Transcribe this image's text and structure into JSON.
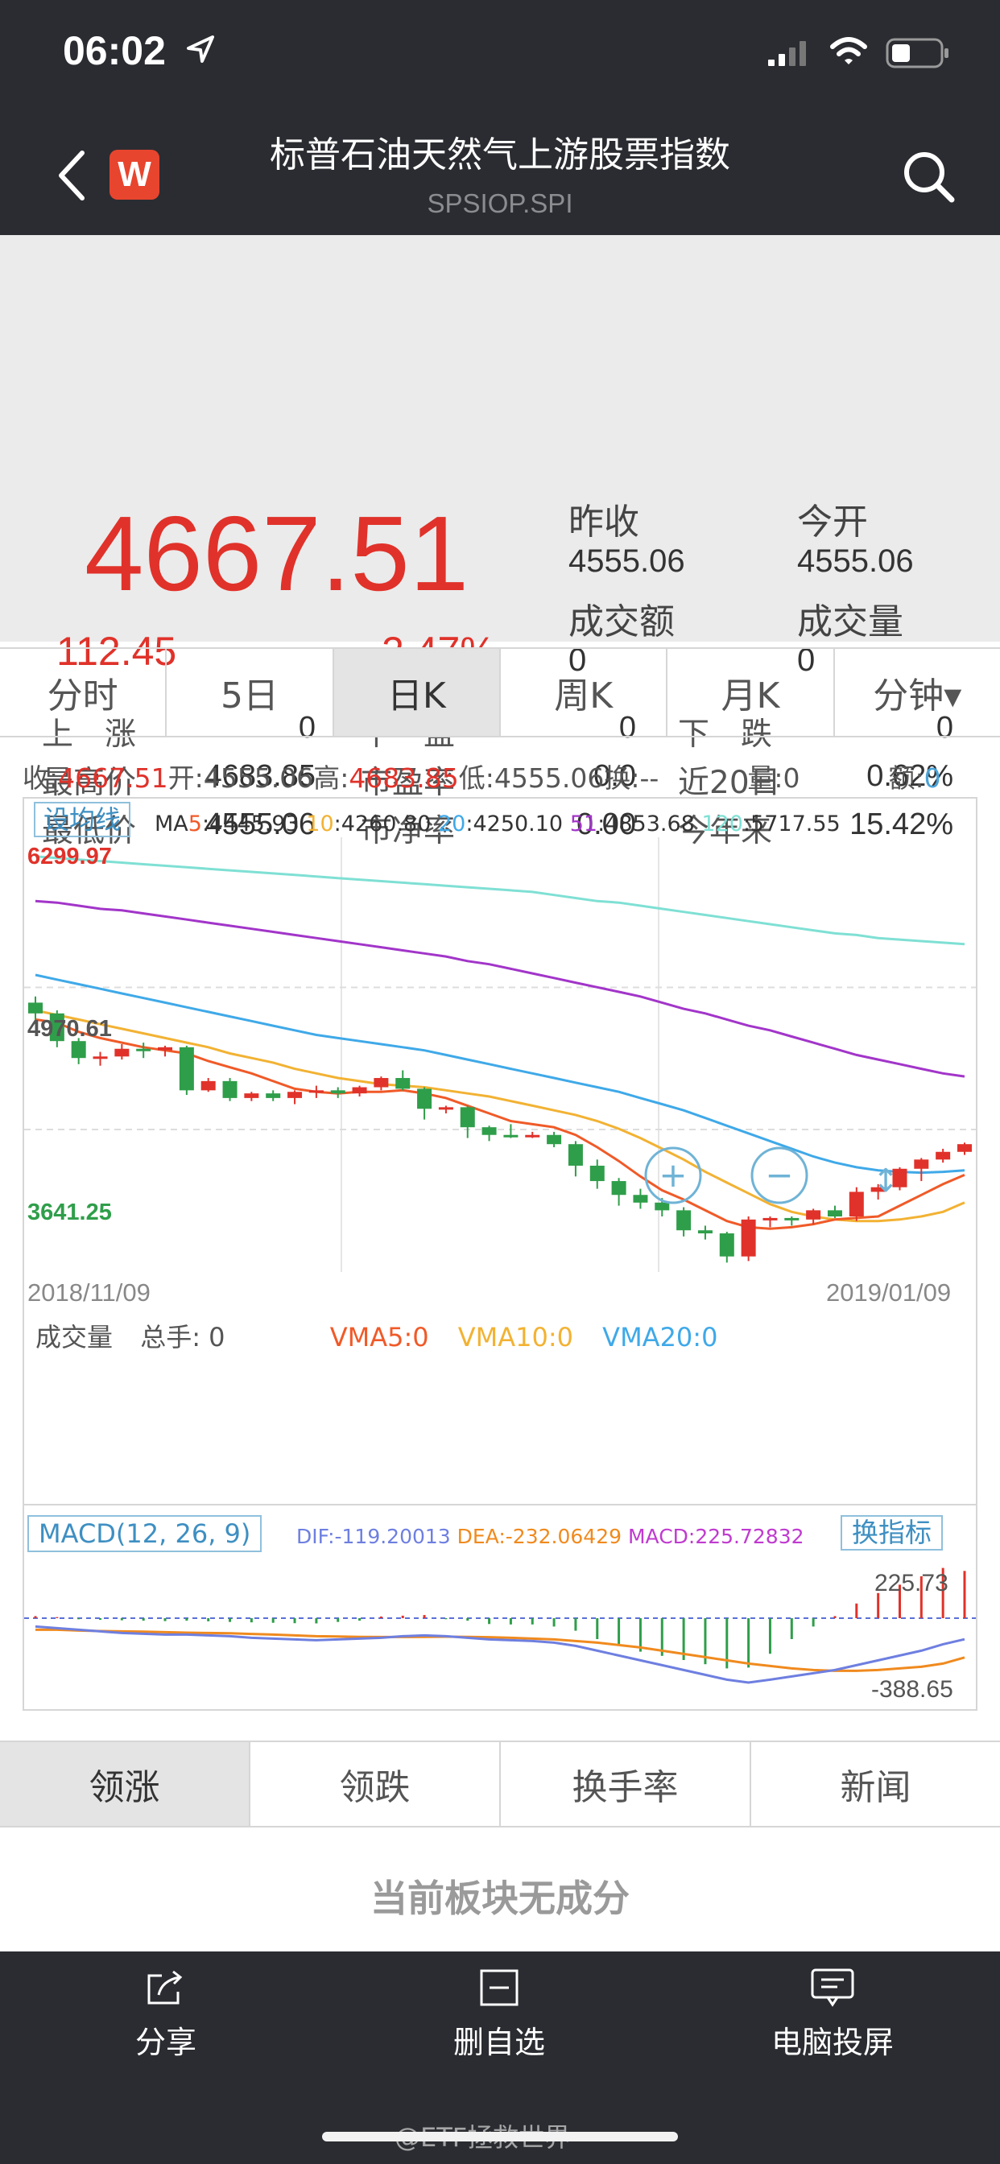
{
  "status": {
    "time": "06:02"
  },
  "header": {
    "logo": "W",
    "title": "标普石油天然气上游股票指数",
    "code": "SPSIOP.SPI"
  },
  "quote": {
    "price": "4667.51",
    "change": "112.45",
    "change_pct": "2.47%",
    "prev_close_label": "昨收",
    "prev_close": "4555.06",
    "open_label": "今开",
    "open": "4555.06",
    "turnover_label": "成交额",
    "turnover": "0",
    "volume_label": "成交量",
    "volume": "0"
  },
  "stats": [
    {
      "label": "上　涨",
      "value": "0"
    },
    {
      "label": "平　盘",
      "value": "0"
    },
    {
      "label": "下　跌",
      "value": "0"
    },
    {
      "label": "最高价",
      "value": "4683.85"
    },
    {
      "label": "市盈率",
      "value": "0.0"
    },
    {
      "label": "近20日",
      "value": "0.62%"
    },
    {
      "label": "最低价",
      "value": "4555.06"
    },
    {
      "label": "市净率",
      "value": "0.00"
    },
    {
      "label": "今年来",
      "value": "15.42%"
    }
  ],
  "tabs": [
    "分时",
    "5日",
    "日K",
    "周K",
    "月K",
    "分钟▾"
  ],
  "info": {
    "close_l": "收:",
    "close": "4667.51",
    "open_l": "开:",
    "open": "4555.06",
    "high_l": "高:",
    "high": "4683.85",
    "low_l": "低:",
    "low": "4555.06",
    "turn_l": "换:",
    "turn": "--",
    "vol_l": "量:",
    "vol": "0",
    "amt_l": "额:",
    "amt": "0"
  },
  "ma": {
    "btn": "设均线",
    "ma5_l": "MA",
    "ma5_n": "5",
    "ma5": ":4445.93",
    "ma10_n": "10",
    "ma10": ":4260.80",
    "ma20_n": "20",
    "ma20": ":4250.10",
    "ma51_n": "51",
    "ma51": ":4853.68",
    "ma120_n": "120",
    "ma120": ":5717.55"
  },
  "axis": {
    "top": "6299.97",
    "mid": "4970.61",
    "bottom": "3641.25",
    "date_start": "2018/11/09",
    "date_end": "2019/01/09"
  },
  "volume_panel": {
    "label": "成交量",
    "hand_l": "总手:",
    "hand": "0",
    "vma5": "VMA5:0",
    "vma10": "VMA10:0",
    "vma20": "VMA20:0"
  },
  "macd": {
    "label": "MACD(12, 26, 9)",
    "dif": "DIF:-119.20013",
    "dea": "DEA:-232.06429",
    "macd": "MACD:225.72832",
    "button": "换指标",
    "max": "225.73",
    "min": "-388.65"
  },
  "bottom_tabs": [
    "领涨",
    "领跌",
    "换手率",
    "新闻"
  ],
  "empty_msg": "当前板块无成分",
  "bottom_nav": {
    "share": "分享",
    "remove": "删自选",
    "cast": "电脑投屏"
  },
  "watermark": "@ETF拯救世界",
  "colors": {
    "up": "#e0322a",
    "down": "#2f9e4a",
    "ma5": "#f05a28",
    "ma10": "#f2b233",
    "ma20": "#3fa9e8",
    "ma51": "#a235c9",
    "ma120": "#7fe0d4"
  },
  "chart_data": {
    "type": "candlestick",
    "x_range": [
      "2018/11/09",
      "2019/01/09"
    ],
    "ylim": [
      3641.25,
      6299.97
    ],
    "candles": [
      [
        5340,
        5380,
        5200,
        5270
      ],
      [
        5270,
        5290,
        5050,
        5090
      ],
      [
        5090,
        5110,
        4940,
        4980
      ],
      [
        4980,
        5020,
        4930,
        4990
      ],
      [
        4990,
        5070,
        4970,
        5040
      ],
      [
        5040,
        5080,
        4980,
        5030
      ],
      [
        5030,
        5060,
        4990,
        5050
      ],
      [
        5050,
        5060,
        4740,
        4770
      ],
      [
        4770,
        4850,
        4760,
        4830
      ],
      [
        4830,
        4850,
        4700,
        4720
      ],
      [
        4720,
        4760,
        4700,
        4750
      ],
      [
        4750,
        4770,
        4700,
        4720
      ],
      [
        4720,
        4770,
        4680,
        4760
      ],
      [
        4760,
        4800,
        4720,
        4770
      ],
      [
        4770,
        4790,
        4720,
        4750
      ],
      [
        4750,
        4800,
        4730,
        4790
      ],
      [
        4790,
        4860,
        4770,
        4850
      ],
      [
        4850,
        4900,
        4770,
        4780
      ],
      [
        4780,
        4790,
        4580,
        4650
      ],
      [
        4650,
        4670,
        4620,
        4660
      ],
      [
        4660,
        4670,
        4460,
        4530
      ],
      [
        4530,
        4540,
        4440,
        4480
      ],
      [
        4480,
        4550,
        4460,
        4470
      ],
      [
        4470,
        4500,
        4460,
        4480
      ],
      [
        4480,
        4500,
        4400,
        4420
      ],
      [
        4420,
        4440,
        4210,
        4280
      ],
      [
        4280,
        4320,
        4130,
        4180
      ],
      [
        4180,
        4200,
        4020,
        4090
      ],
      [
        4090,
        4130,
        4000,
        4040
      ],
      [
        4040,
        4070,
        3950,
        3990
      ],
      [
        3990,
        4010,
        3820,
        3860
      ],
      [
        3860,
        3890,
        3800,
        3840
      ],
      [
        3840,
        3850,
        3650,
        3690
      ],
      [
        3690,
        3950,
        3660,
        3930
      ],
      [
        3930,
        3950,
        3880,
        3940
      ],
      [
        3940,
        3950,
        3890,
        3930
      ],
      [
        3930,
        4000,
        3900,
        3990
      ],
      [
        3990,
        4020,
        3940,
        3950
      ],
      [
        3950,
        4140,
        3920,
        4110
      ],
      [
        4110,
        4160,
        4060,
        4140
      ],
      [
        4140,
        4270,
        4120,
        4260
      ],
      [
        4260,
        4330,
        4180,
        4320
      ],
      [
        4320,
        4390,
        4300,
        4370
      ],
      [
        4370,
        4430,
        4350,
        4420
      ]
    ],
    "ma5": [
      5230,
      5210,
      5150,
      5110,
      5080,
      5050,
      5030,
      5010,
      4960,
      4920,
      4880,
      4830,
      4780,
      4760,
      4750,
      4760,
      4760,
      4770,
      4750,
      4720,
      4670,
      4620,
      4570,
      4550,
      4530,
      4480,
      4400,
      4310,
      4210,
      4120,
      4060,
      3990,
      3920,
      3880,
      3870,
      3880,
      3900,
      3930,
      3940,
      3950,
      4020,
      4090,
      4160,
      4220
    ],
    "ma10": [
      5290,
      5260,
      5230,
      5200,
      5170,
      5140,
      5110,
      5080,
      5050,
      5010,
      4980,
      4950,
      4910,
      4880,
      4850,
      4830,
      4810,
      4800,
      4790,
      4770,
      4750,
      4730,
      4700,
      4670,
      4640,
      4610,
      4570,
      4520,
      4460,
      4390,
      4320,
      4240,
      4170,
      4100,
      4030,
      3980,
      3950,
      3930,
      3920,
      3920,
      3930,
      3950,
      3980,
      4040
    ],
    "ma20": [
      5520,
      5490,
      5460,
      5430,
      5400,
      5370,
      5340,
      5310,
      5280,
      5250,
      5220,
      5190,
      5160,
      5130,
      5110,
      5090,
      5070,
      5050,
      5030,
      5000,
      4970,
      4940,
      4910,
      4880,
      4850,
      4820,
      4790,
      4760,
      4720,
      4680,
      4640,
      4590,
      4540,
      4490,
      4440,
      4390,
      4340,
      4300,
      4270,
      4250,
      4240,
      4235,
      4240,
      4250
    ],
    "ma51": [
      6000,
      5990,
      5970,
      5950,
      5940,
      5920,
      5900,
      5880,
      5860,
      5840,
      5820,
      5800,
      5780,
      5760,
      5740,
      5720,
      5700,
      5680,
      5660,
      5640,
      5610,
      5590,
      5560,
      5530,
      5500,
      5470,
      5440,
      5410,
      5380,
      5340,
      5300,
      5270,
      5230,
      5190,
      5160,
      5120,
      5080,
      5040,
      5000,
      4970,
      4940,
      4910,
      4880,
      4860
    ],
    "ma120": [
      6290,
      6280,
      6270,
      6260,
      6250,
      6240,
      6230,
      6220,
      6210,
      6200,
      6190,
      6180,
      6170,
      6160,
      6150,
      6140,
      6130,
      6120,
      6110,
      6100,
      6090,
      6080,
      6070,
      6060,
      6040,
      6020,
      6000,
      5990,
      5970,
      5950,
      5930,
      5910,
      5890,
      5870,
      5850,
      5830,
      5810,
      5790,
      5780,
      5760,
      5750,
      5740,
      5730,
      5720
    ],
    "macd_dif": [
      -40,
      -50,
      -60,
      -70,
      -80,
      -85,
      -90,
      -90,
      -95,
      -100,
      -110,
      -115,
      -120,
      -125,
      -120,
      -115,
      -110,
      -100,
      -95,
      -100,
      -110,
      -120,
      -125,
      -130,
      -140,
      -160,
      -190,
      -220,
      -250,
      -280,
      -310,
      -340,
      -370,
      -388,
      -370,
      -350,
      -330,
      -310,
      -280,
      -250,
      -220,
      -190,
      -150,
      -119
    ],
    "macd_dea": [
      -60,
      -60,
      -65,
      -68,
      -70,
      -72,
      -75,
      -78,
      -80,
      -82,
      -86,
      -90,
      -95,
      -100,
      -102,
      -104,
      -105,
      -105,
      -104,
      -103,
      -104,
      -106,
      -110,
      -115,
      -120,
      -130,
      -140,
      -155,
      -170,
      -190,
      -210,
      -230,
      -250,
      -270,
      -285,
      -300,
      -310,
      -315,
      -315,
      -310,
      -300,
      -290,
      -270,
      -232
    ],
    "macd_hist": [
      10,
      5,
      -5,
      -8,
      -10,
      -12,
      -14,
      -12,
      -15,
      -18,
      -20,
      -22,
      -24,
      -25,
      -18,
      -12,
      8,
      12,
      15,
      -5,
      -12,
      -28,
      -30,
      -30,
      -40,
      -60,
      -100,
      -130,
      -160,
      -180,
      -200,
      -220,
      -240,
      -236,
      -170,
      -100,
      -40,
      10,
      70,
      120,
      160,
      200,
      240,
      225.73
    ]
  }
}
